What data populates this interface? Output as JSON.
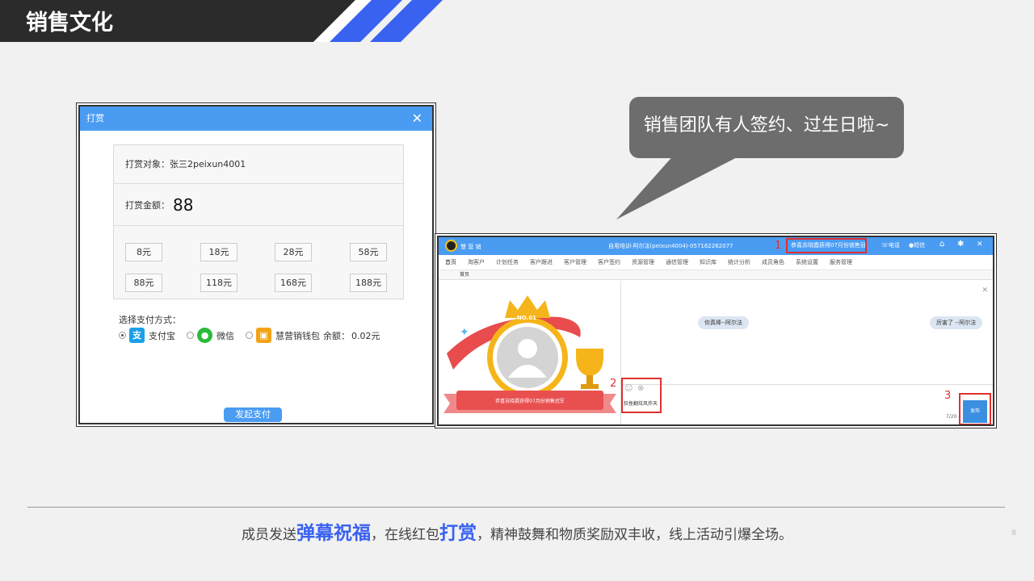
{
  "header": {
    "title": "销售文化"
  },
  "reward_dialog": {
    "title": "打赏",
    "close": "✕",
    "target_label": "打赏对象：",
    "target_value": "张三2peixun4001",
    "amount_label": "打赏金额：",
    "amount_value": "88",
    "options": [
      "8元",
      "18元",
      "28元",
      "58元",
      "88元",
      "118元",
      "168元",
      "188元"
    ],
    "pay_method_label": "选择支付方式：",
    "pay_methods": [
      {
        "name": "支付宝",
        "selected": true,
        "color": "#1aa0e8"
      },
      {
        "name": "微信",
        "selected": false,
        "color": "#2bbb3a"
      },
      {
        "name": "慧营销钱包",
        "selected": false,
        "color": "#f2a316"
      }
    ],
    "balance_label": "余额：",
    "balance_value": "0.02元",
    "submit_label": "发起支付"
  },
  "bubble": {
    "text": "销售团队有人签约、过生日啦~"
  },
  "app_window": {
    "app_name": "慧 营 销",
    "user_info": "自用培训-阿尔法(peixun4004)-057162262077",
    "notice_text": "恭喜苏晓霞获得07月份销售冠军",
    "toolbar": {
      "phone": "电话",
      "sms": "短信",
      "home_icon": "home-icon",
      "settings_icon": "gear-icon",
      "close": "✕"
    },
    "menu": [
      "首页",
      "淘客户",
      "计划任务",
      "客户跟进",
      "客户管理",
      "客户签约",
      "资源管理",
      "通信管理",
      "知识库",
      "统计分析",
      "成员角色",
      "系统设置",
      "服务管理"
    ],
    "tab": "首页",
    "badge_text": "NO.01",
    "banner_text": "恭喜苏晓霞获得07月份销售冠军",
    "messages": [
      "你真棒--阿尔法",
      "厉害了 --阿尔法"
    ],
    "input_text": "狂挫翻炫风炸天",
    "annotations": [
      "1",
      "2",
      "3"
    ],
    "send_label": "发布",
    "date_fragment": "7/20"
  },
  "footer": {
    "prefix": "成员发送",
    "hl1": "弹幕祝福",
    "mid": "，在线红包",
    "hl2": "打赏",
    "suffix": "，精神鼓舞和物质奖励双丰收，线上活动引爆全场。"
  },
  "page_number": "8"
}
